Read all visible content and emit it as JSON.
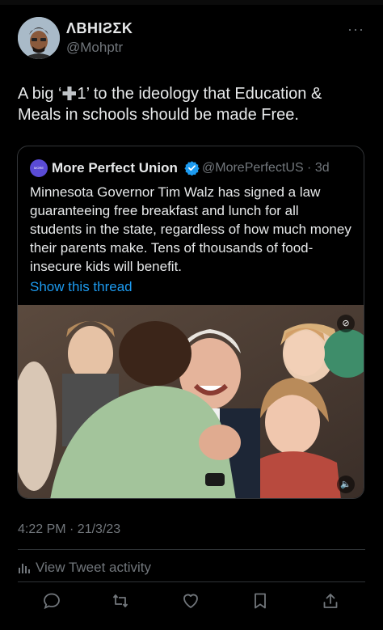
{
  "author": {
    "display_name": "ΛBHIƧΣK",
    "handle": "@Mohptr"
  },
  "menu": {
    "more_label": "···"
  },
  "tweet": {
    "text_before": "A big ‘",
    "text_after": "1’ to the ideology that Education & Meals in schools should be made Free.",
    "emoji_icon": "heavy-plus-sign"
  },
  "quote": {
    "avatar_text": "MORE PERFECT UNION",
    "name": "More Perfect Union",
    "handle_date": "@MorePerfectUS · 3d",
    "text": "Minnesota Governor Tim Walz has signed a law guaranteeing free breakfast and lunch for all students in the state, regardless of how much money their parents make. Tens of thousands of food-insecure kids will benefit.",
    "show_thread": "Show this thread",
    "media": {
      "description_icons": [
        "autoplay-icon",
        "mute-icon"
      ]
    }
  },
  "meta": {
    "timestamp": "4:22 PM · 21/3/23",
    "activity_label": "View Tweet activity"
  },
  "colors": {
    "background": "#000000",
    "text": "#e7e9ea",
    "secondary": "#71767b",
    "link": "#1d9bf0",
    "verified": "#1d9bf0"
  }
}
